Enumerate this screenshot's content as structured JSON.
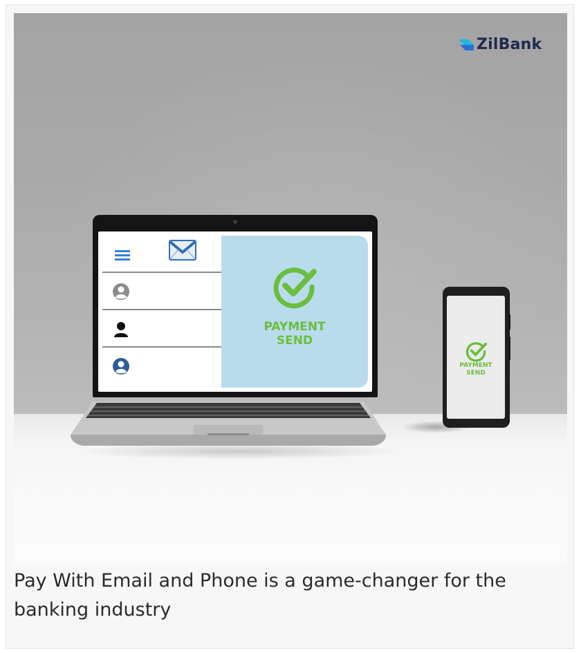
{
  "brand": {
    "name": "ZilBank",
    "text_color": "#1f2a4d",
    "logo_icon": "zilbank-wing-logo-icon",
    "logo_colors": [
      "#2b6fd6",
      "#1fb6e0"
    ]
  },
  "laptop": {
    "sidebar_icons": [
      "hamburger-menu-icon",
      "mail-icon"
    ],
    "contact_rows": [
      {
        "icon": "user-circle-gray-icon"
      },
      {
        "icon": "user-black-icon"
      },
      {
        "icon": "user-circle-blue-icon"
      }
    ],
    "status_line1": "PAYMENT",
    "status_line2": "SEND",
    "status_icon": "checkmark-circle-icon",
    "status_color": "#6cbd3e",
    "panel_color": "#b9dced"
  },
  "phone": {
    "status_line1": "PAYMENT",
    "status_line2": "SEND",
    "status_icon": "checkmark-circle-icon"
  },
  "caption": "Pay With Email and Phone is a game-changer for the banking industry"
}
